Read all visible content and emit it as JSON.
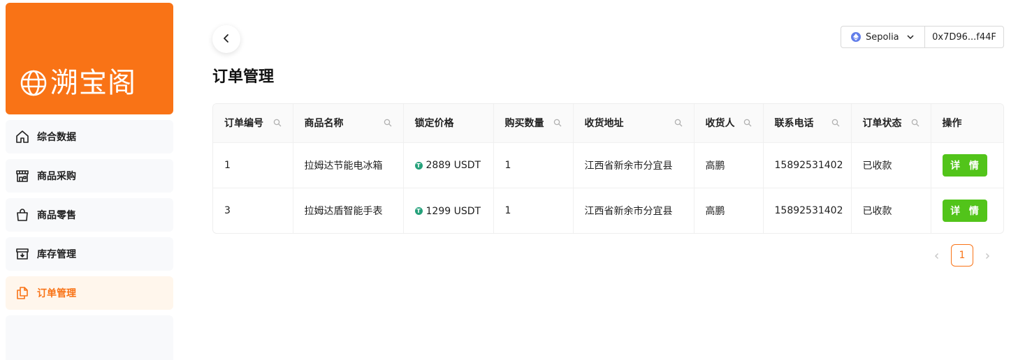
{
  "app": {
    "logo_text": "溯宝阁"
  },
  "sidebar": {
    "items": [
      {
        "label": "综合数据",
        "icon": "home-icon"
      },
      {
        "label": "商品采购",
        "icon": "store-icon"
      },
      {
        "label": "商品零售",
        "icon": "shopping-bag-icon"
      },
      {
        "label": "库存管理",
        "icon": "archive-box-icon"
      },
      {
        "label": "订单管理",
        "icon": "copy-document-icon",
        "active": true
      }
    ]
  },
  "header": {
    "title": "订单管理",
    "network": "Sepolia",
    "address": "0x7D96...f44F"
  },
  "table": {
    "columns": [
      "订单编号",
      "商品名称",
      "锁定价格",
      "购买数量",
      "收货地址",
      "收货人",
      "联系电话",
      "订单状态",
      "操作"
    ],
    "rows": [
      {
        "id": "1",
        "product": "拉姆达节能电冰箱",
        "price": "2889 USDT",
        "qty": "1",
        "address": "江西省新余市分宜县",
        "receiver": "高鹏",
        "phone": "15892531402",
        "status": "已收款",
        "action": "详 情"
      },
      {
        "id": "3",
        "product": "拉姆达盾智能手表",
        "price": "1299 USDT",
        "qty": "1",
        "address": "江西省新余市分宜县",
        "receiver": "高鹏",
        "phone": "15892531402",
        "status": "已收款",
        "action": "详 情"
      }
    ]
  },
  "pagination": {
    "current_page": "1"
  },
  "colors": {
    "brand": "#f97316",
    "success": "#52c41a",
    "usdt": "#26a17b"
  }
}
